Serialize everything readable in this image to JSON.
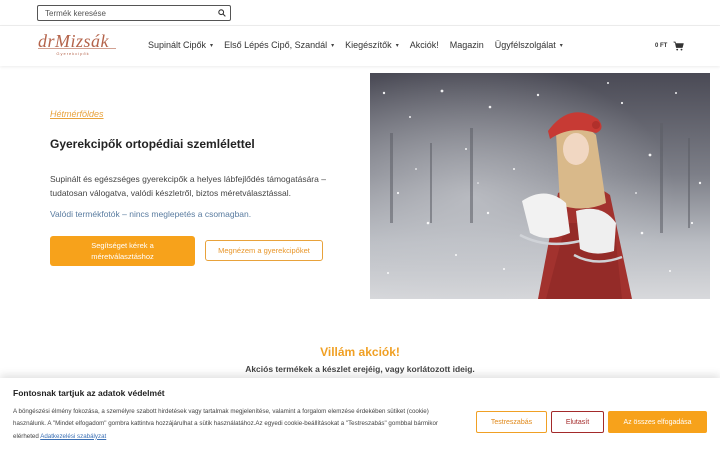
{
  "search": {
    "placeholder": "Termék keresése"
  },
  "logo": {
    "name": "drMizsák",
    "tagline": "Gyerekcipők"
  },
  "nav": {
    "items": [
      {
        "label": "Supinált Cipők",
        "dropdown": true
      },
      {
        "label": "Első Lépés Cipő, Szandál",
        "dropdown": true
      },
      {
        "label": "Kiegészítők",
        "dropdown": true
      },
      {
        "label": "Akciók!",
        "dropdown": false
      },
      {
        "label": "Magazin",
        "dropdown": false
      },
      {
        "label": "Ügyfélszolgálat",
        "dropdown": true
      }
    ]
  },
  "cart": {
    "amount": "0 FT",
    "icon": "cart-icon"
  },
  "hero": {
    "kicker": "Hétmérföldes",
    "title": "Gyerekcipők ortopédiai szemlélettel",
    "text": "Supinált és egészséges gyerekcipők a helyes lábfejlődés támogatására – tudatosan válogatva, valódi készletről, biztos méretválasztással.",
    "note": "Valódi termékfotók – nincs meglepetés a csomagban.",
    "primary_button": "Segítséget kérek a méretválasztáshoz",
    "secondary_button": "Megnézem a gyerekcipőket"
  },
  "flash": {
    "title": "Villám akciók!",
    "subtitle": "Akciós termékek a készlet erejéig, vagy korlátozott ideig."
  },
  "cookie": {
    "title": "Fontosnak tartjuk az adatok védelmét",
    "text": "A böngészési élmény fokozása, a személyre szabott hirdetések vagy tartalmak megjelenítése, valamint a forgalom elemzése érdekében sütiket (cookie) használunk. A \"Mindet elfogadom\" gombra kattintva hozzájárulhat a sütik használatához.Az egyedi cookie-beállításokat a \"Testreszabás\" gombbal bármikor elérheted",
    "policy_link": "Adatkezelési szabályzat",
    "customize_button": "Testreszabás",
    "reject_button": "Elutasít",
    "accept_button": "Az összes elfogadása"
  },
  "colors": {
    "accent": "#f7a21b",
    "brand": "#b4634a",
    "reject": "#a32a2a",
    "link": "#3a6fb4"
  }
}
